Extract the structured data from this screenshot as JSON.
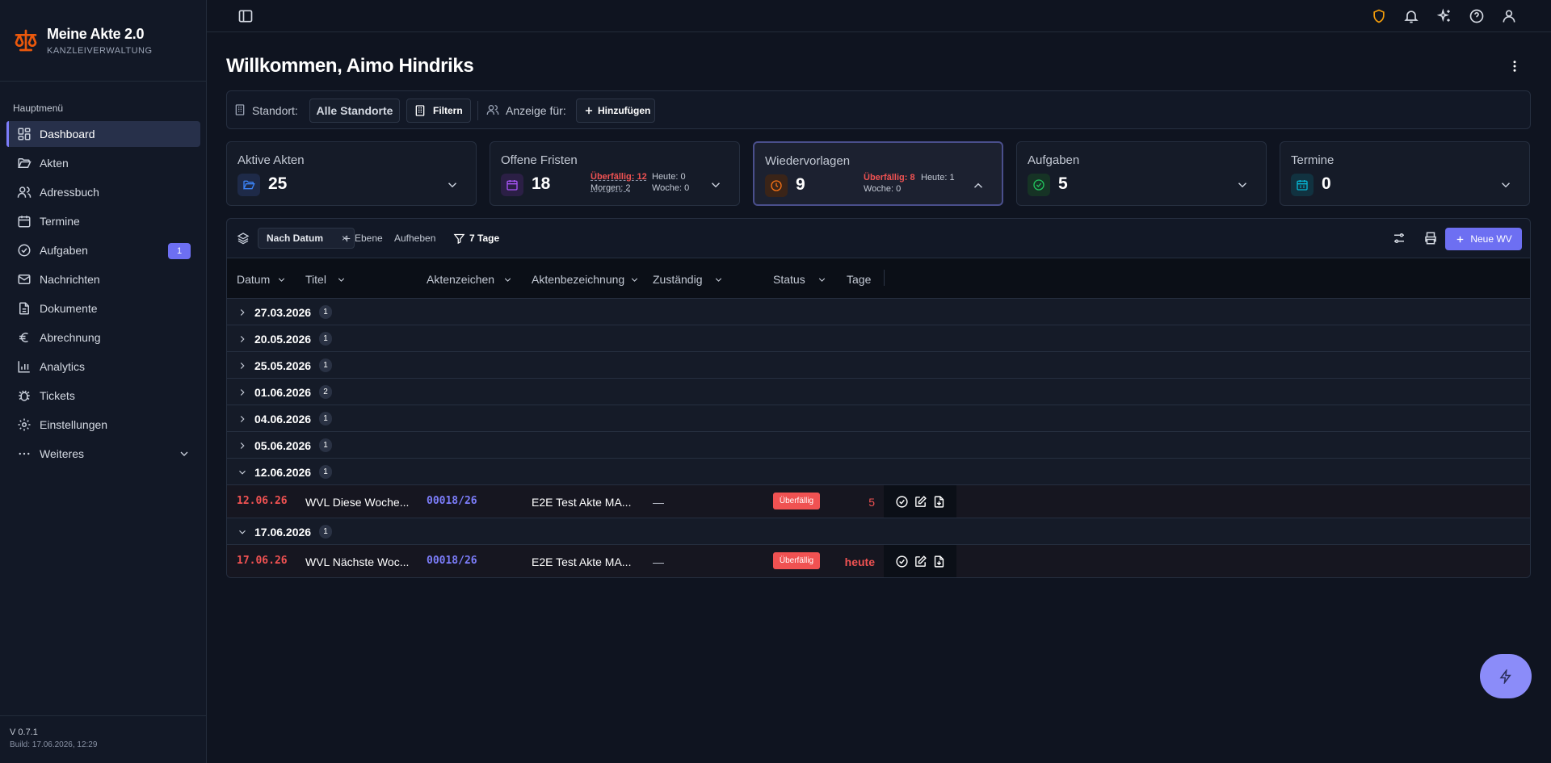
{
  "brand": {
    "title": "Meine Akte 2.0",
    "subtitle": "KANZLEIVERWALTUNG"
  },
  "sidebar": {
    "heading": "Hauptmenü",
    "items": [
      {
        "label": "Dashboard",
        "icon": "dashboard-icon"
      },
      {
        "label": "Akten",
        "icon": "folder-icon"
      },
      {
        "label": "Adressbuch",
        "icon": "users-icon"
      },
      {
        "label": "Termine",
        "icon": "calendar-icon"
      },
      {
        "label": "Aufgaben",
        "icon": "check-circle-icon",
        "badge": "1"
      },
      {
        "label": "Nachrichten",
        "icon": "mail-icon"
      },
      {
        "label": "Dokumente",
        "icon": "file-icon"
      },
      {
        "label": "Abrechnung",
        "icon": "euro-icon"
      },
      {
        "label": "Analytics",
        "icon": "bar-chart-icon"
      },
      {
        "label": "Tickets",
        "icon": "bug-icon"
      },
      {
        "label": "Einstellungen",
        "icon": "gear-icon"
      },
      {
        "label": "Weiteres",
        "icon": "more-icon"
      }
    ],
    "version": "V 0.7.1",
    "build": "Build: 17.06.2026, 12:29"
  },
  "header": {
    "title": "Willkommen, Aimo Hindriks"
  },
  "filterbar": {
    "standort_label": "Standort:",
    "standort_value": "Alle Standorte",
    "filter_label": "Filtern",
    "anzeige_label": "Anzeige für:",
    "add_label": "Hinzufügen"
  },
  "cards": [
    {
      "title": "Aktive Akten",
      "value": "25",
      "color": "#3b82f6"
    },
    {
      "title": "Offene Fristen",
      "value": "18",
      "color": "#a855f7",
      "overdue": "Überfällig: 12",
      "today": "Heute: 0",
      "tomorrow": "Morgen: 2",
      "week": "Woche: 0"
    },
    {
      "title": "Wiedervorlagen",
      "value": "9",
      "color": "#f97316",
      "overdue": "Überfällig: 8",
      "today": "Heute: 1",
      "week": "Woche: 0"
    },
    {
      "title": "Aufgaben",
      "value": "5",
      "color": "#22c55e"
    },
    {
      "title": "Termine",
      "value": "0",
      "color": "#06b6d4"
    }
  ],
  "toolbar": {
    "group_chip": "Nach Datum",
    "level_label": "Ebene",
    "ungroup_label": "Aufheben",
    "range_label": "7 Tage",
    "new_label": "Neue WV"
  },
  "table": {
    "columns": [
      "Datum",
      "Titel",
      "Aktenzeichen",
      "Aktenbezeichnung",
      "Zuständig",
      "Status",
      "Tage"
    ],
    "groups": [
      {
        "date": "27.03.2026",
        "count": "1"
      },
      {
        "date": "20.05.2026",
        "count": "1"
      },
      {
        "date": "25.05.2026",
        "count": "1"
      },
      {
        "date": "01.06.2026",
        "count": "2"
      },
      {
        "date": "04.06.2026",
        "count": "1"
      },
      {
        "date": "05.06.2026",
        "count": "1"
      },
      {
        "date": "12.06.2026",
        "count": "1"
      },
      {
        "date": "17.06.2026",
        "count": "1"
      }
    ],
    "rows": [
      {
        "datum": "12.06.26",
        "titel": "WVL Diese Woche...",
        "aktenzeichen": "00018/26",
        "bezeichnung": "E2E Test Akte MA...",
        "zustaendig": "—",
        "status": "Überfällig",
        "tage": "5"
      },
      {
        "datum": "17.06.26",
        "titel": "WVL Nächste Woc...",
        "aktenzeichen": "00018/26",
        "bezeichnung": "E2E Test Akte MA...",
        "zustaendig": "—",
        "status": "Überfällig",
        "tage": "heute"
      }
    ]
  },
  "colors": {
    "accent": "#6d6ff2",
    "danger": "#f05252",
    "link": "#7c7dfa"
  }
}
